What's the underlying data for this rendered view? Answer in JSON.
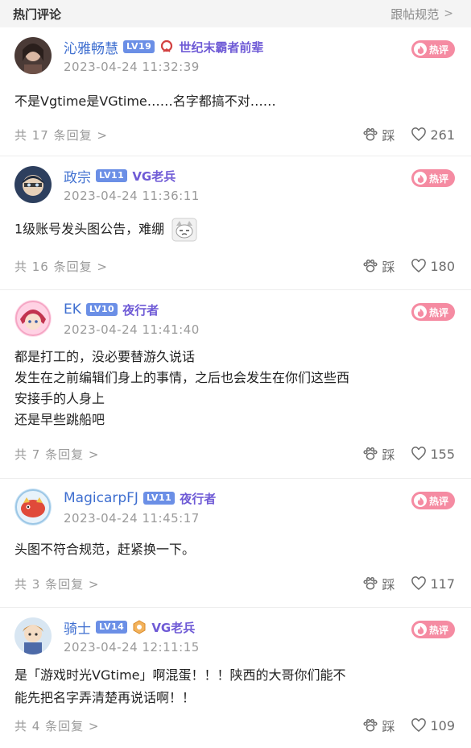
{
  "header": {
    "title": "热门评论",
    "link_label": "跟帖规范",
    "chevron": ">"
  },
  "hot_label": "热评",
  "icons": {
    "paw": "paw-icon",
    "heart": "heart-icon",
    "flame": "flame-icon"
  },
  "colors": {
    "username": "#3f6fd0",
    "level_badge": "#6b8fe6",
    "title_text": "#6f5bd6",
    "hot_badge": "#f58ba2"
  },
  "comments": [
    {
      "username": "沁雅畅慧",
      "level": "LV19",
      "title": "世纪末霸者前辈",
      "timestamp": "2023-04-24 11:32:39",
      "lines": [
        "不是Vgtime是VGtime……名字都搞不对……"
      ],
      "reply_count": "共 17 条回复 >",
      "dislike_label": "踩",
      "likes": "261"
    },
    {
      "username": "政宗",
      "level": "LV11",
      "title": "VG老兵",
      "timestamp": "2023-04-24 11:36:11",
      "lines": [
        "1级账号发头图公告，难绷"
      ],
      "reply_count": "共 16 条回复 >",
      "dislike_label": "踩",
      "likes": "180"
    },
    {
      "username": "EK",
      "level": "LV10",
      "title": "夜行者",
      "timestamp": "2023-04-24 11:41:40",
      "lines": [
        "都是打工的，没必要替游久说话",
        "发生在之前编辑们身上的事情，之后也会发生在你们这些西",
        "安接手的人身上",
        "还是早些跳船吧"
      ],
      "reply_count": "共 7 条回复 >",
      "dislike_label": "踩",
      "likes": "155"
    },
    {
      "username": "MagicarpFJ",
      "level": "LV11",
      "title": "夜行者",
      "timestamp": "2023-04-24 11:45:17",
      "lines": [
        "头图不符合规范，赶紧换一下。"
      ],
      "reply_count": "共 3 条回复 >",
      "dislike_label": "踩",
      "likes": "117"
    },
    {
      "username": "骑士",
      "level": "LV14",
      "title": "VG老兵",
      "timestamp": "2023-04-24 12:11:15",
      "lines": [
        "是「游戏时光VGtime」啊混蛋！！！陕西的大哥你们能不",
        "能先把名字弄清楚再说话啊！！"
      ],
      "reply_count": "共 4 条回复 >",
      "dislike_label": "踩",
      "likes": "109"
    }
  ]
}
